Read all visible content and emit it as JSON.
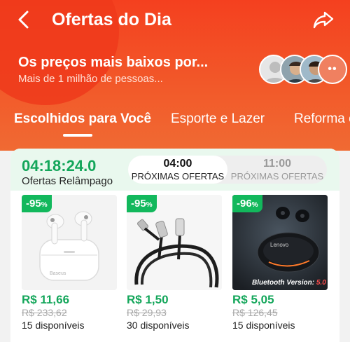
{
  "header": {
    "title": "Ofertas do Dia",
    "headline": "Os preços mais baixos por...",
    "subline": "Mais de 1 milhão de pessoas...",
    "more_avatars": "••"
  },
  "tabs": [
    {
      "label": "Escolhidos para Você"
    },
    {
      "label": "Esporte e Lazer"
    },
    {
      "label": "Reforma e"
    }
  ],
  "flash": {
    "timer": "04:18:24.0",
    "label": "Ofertas Relâmpago",
    "slots": [
      {
        "time": "04:00",
        "label": "PRÓXIMAS OFERTAS"
      },
      {
        "time": "11:00",
        "label": "PRÓXIMAS OFERTAS"
      }
    ]
  },
  "products": [
    {
      "discount": "-95",
      "pct": "%",
      "price": "R$ 11,66",
      "old_price": "R$ 233,62",
      "available": "15  disponíveis",
      "brand": "Baseus"
    },
    {
      "discount": "-95",
      "pct": "%",
      "price": "R$ 1,50",
      "old_price": "R$ 29,93",
      "available": "30  disponíveis"
    },
    {
      "discount": "-96",
      "pct": "%",
      "price": "R$ 5,05",
      "old_price": "R$ 126,45",
      "available": "15  disponíveis",
      "brand": "Lenovo",
      "image_text": "Bluetooth Version:",
      "image_text_value": "5.0"
    }
  ],
  "colors": {
    "accent": "#f4401f",
    "green": "#13a65a",
    "discount_badge": "#12b85c"
  }
}
